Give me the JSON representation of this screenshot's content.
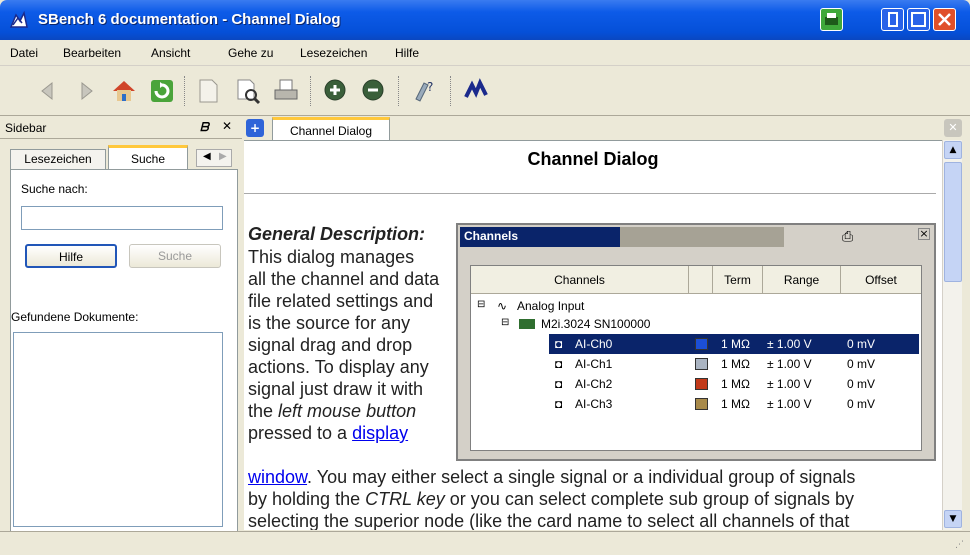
{
  "window": {
    "title": "SBench 6 documentation - Channel Dialog"
  },
  "menu": [
    "Datei",
    "Bearbeiten",
    "Ansicht",
    "Gehe zu",
    "Lesezeichen",
    "Hilfe"
  ],
  "toolbar": {
    "icons": [
      "back-icon",
      "forward-icon",
      "home-icon",
      "reload-icon",
      "page-icon",
      "print-preview-icon",
      "print-icon",
      "zoom-in-icon",
      "zoom-out-icon",
      "help-icon",
      "spectrum-logo-icon"
    ]
  },
  "sidebar": {
    "title": "Sidebar",
    "tabs": [
      "Lesezeichen",
      "Suche"
    ],
    "search_label": "Suche nach:",
    "search_value": "",
    "help_button": "Hilfe",
    "search_button": "Suche",
    "found_label": "Gefundene Dokumente:"
  },
  "main": {
    "tab_label": "Channel Dialog",
    "heading": "Channel Dialog",
    "section_title": "General Description:",
    "para_lines": [
      "This dialog manages",
      "all the channel and data",
      "file related settings and",
      "is the source for any",
      "signal drag and drop",
      "actions. To display any",
      "signal just draw it with"
    ],
    "line_the": "the ",
    "line_italic": "left mouse button",
    "line_pressed": "pressed to a ",
    "link_text_1": "display",
    "link_text_2": "window",
    "full_line_1": ". You may either select a single signal or a individual group of signals",
    "full_line_2a": "by holding the ",
    "full_line_2_italic": "CTRL key",
    "full_line_2b": " or you can select complete sub group of signals by",
    "full_line_3": "selecting the superior node (like the card name to select all channels of that"
  },
  "channels_dialog": {
    "title": "Channels",
    "columns": [
      "Channels",
      "",
      "Term",
      "Range",
      "Offset"
    ],
    "root": "Analog Input",
    "card": "M2i.3024 SN100000",
    "rows": [
      {
        "name": "AI-Ch0",
        "color": "#1c4fd6",
        "term": "1 MΩ",
        "range": "± 1.00 V",
        "offset": "0 mV",
        "selected": true
      },
      {
        "name": "AI-Ch1",
        "color": "#aab4c2",
        "term": "1 MΩ",
        "range": "± 1.00 V",
        "offset": "0 mV",
        "selected": false
      },
      {
        "name": "AI-Ch2",
        "color": "#c23a1a",
        "term": "1 MΩ",
        "range": "± 1.00 V",
        "offset": "0 mV",
        "selected": false
      },
      {
        "name": "AI-Ch3",
        "color": "#a88a4a",
        "term": "1 MΩ",
        "range": "± 1.00 V",
        "offset": "0 mV",
        "selected": false
      }
    ]
  },
  "colors": {
    "title_blue": "#0550d8",
    "selection": "#0a246a"
  }
}
